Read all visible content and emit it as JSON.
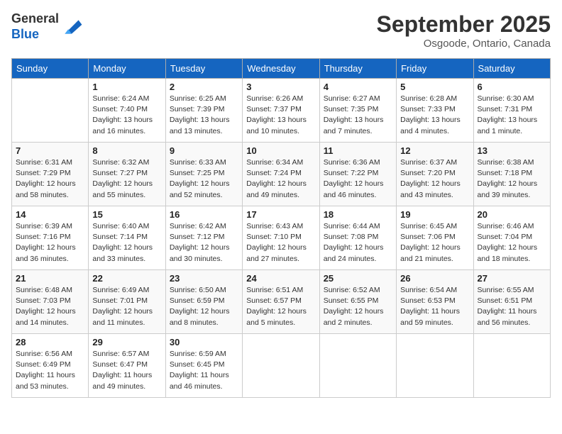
{
  "header": {
    "logo_line1": "General",
    "logo_line2": "Blue",
    "month": "September 2025",
    "location": "Osgoode, Ontario, Canada"
  },
  "days_of_week": [
    "Sunday",
    "Monday",
    "Tuesday",
    "Wednesday",
    "Thursday",
    "Friday",
    "Saturday"
  ],
  "weeks": [
    [
      {
        "day": "",
        "sunrise": "",
        "sunset": "",
        "daylight": ""
      },
      {
        "day": "1",
        "sunrise": "Sunrise: 6:24 AM",
        "sunset": "Sunset: 7:40 PM",
        "daylight": "Daylight: 13 hours and 16 minutes."
      },
      {
        "day": "2",
        "sunrise": "Sunrise: 6:25 AM",
        "sunset": "Sunset: 7:39 PM",
        "daylight": "Daylight: 13 hours and 13 minutes."
      },
      {
        "day": "3",
        "sunrise": "Sunrise: 6:26 AM",
        "sunset": "Sunset: 7:37 PM",
        "daylight": "Daylight: 13 hours and 10 minutes."
      },
      {
        "day": "4",
        "sunrise": "Sunrise: 6:27 AM",
        "sunset": "Sunset: 7:35 PM",
        "daylight": "Daylight: 13 hours and 7 minutes."
      },
      {
        "day": "5",
        "sunrise": "Sunrise: 6:28 AM",
        "sunset": "Sunset: 7:33 PM",
        "daylight": "Daylight: 13 hours and 4 minutes."
      },
      {
        "day": "6",
        "sunrise": "Sunrise: 6:30 AM",
        "sunset": "Sunset: 7:31 PM",
        "daylight": "Daylight: 13 hours and 1 minute."
      }
    ],
    [
      {
        "day": "7",
        "sunrise": "Sunrise: 6:31 AM",
        "sunset": "Sunset: 7:29 PM",
        "daylight": "Daylight: 12 hours and 58 minutes."
      },
      {
        "day": "8",
        "sunrise": "Sunrise: 6:32 AM",
        "sunset": "Sunset: 7:27 PM",
        "daylight": "Daylight: 12 hours and 55 minutes."
      },
      {
        "day": "9",
        "sunrise": "Sunrise: 6:33 AM",
        "sunset": "Sunset: 7:25 PM",
        "daylight": "Daylight: 12 hours and 52 minutes."
      },
      {
        "day": "10",
        "sunrise": "Sunrise: 6:34 AM",
        "sunset": "Sunset: 7:24 PM",
        "daylight": "Daylight: 12 hours and 49 minutes."
      },
      {
        "day": "11",
        "sunrise": "Sunrise: 6:36 AM",
        "sunset": "Sunset: 7:22 PM",
        "daylight": "Daylight: 12 hours and 46 minutes."
      },
      {
        "day": "12",
        "sunrise": "Sunrise: 6:37 AM",
        "sunset": "Sunset: 7:20 PM",
        "daylight": "Daylight: 12 hours and 43 minutes."
      },
      {
        "day": "13",
        "sunrise": "Sunrise: 6:38 AM",
        "sunset": "Sunset: 7:18 PM",
        "daylight": "Daylight: 12 hours and 39 minutes."
      }
    ],
    [
      {
        "day": "14",
        "sunrise": "Sunrise: 6:39 AM",
        "sunset": "Sunset: 7:16 PM",
        "daylight": "Daylight: 12 hours and 36 minutes."
      },
      {
        "day": "15",
        "sunrise": "Sunrise: 6:40 AM",
        "sunset": "Sunset: 7:14 PM",
        "daylight": "Daylight: 12 hours and 33 minutes."
      },
      {
        "day": "16",
        "sunrise": "Sunrise: 6:42 AM",
        "sunset": "Sunset: 7:12 PM",
        "daylight": "Daylight: 12 hours and 30 minutes."
      },
      {
        "day": "17",
        "sunrise": "Sunrise: 6:43 AM",
        "sunset": "Sunset: 7:10 PM",
        "daylight": "Daylight: 12 hours and 27 minutes."
      },
      {
        "day": "18",
        "sunrise": "Sunrise: 6:44 AM",
        "sunset": "Sunset: 7:08 PM",
        "daylight": "Daylight: 12 hours and 24 minutes."
      },
      {
        "day": "19",
        "sunrise": "Sunrise: 6:45 AM",
        "sunset": "Sunset: 7:06 PM",
        "daylight": "Daylight: 12 hours and 21 minutes."
      },
      {
        "day": "20",
        "sunrise": "Sunrise: 6:46 AM",
        "sunset": "Sunset: 7:04 PM",
        "daylight": "Daylight: 12 hours and 18 minutes."
      }
    ],
    [
      {
        "day": "21",
        "sunrise": "Sunrise: 6:48 AM",
        "sunset": "Sunset: 7:03 PM",
        "daylight": "Daylight: 12 hours and 14 minutes."
      },
      {
        "day": "22",
        "sunrise": "Sunrise: 6:49 AM",
        "sunset": "Sunset: 7:01 PM",
        "daylight": "Daylight: 12 hours and 11 minutes."
      },
      {
        "day": "23",
        "sunrise": "Sunrise: 6:50 AM",
        "sunset": "Sunset: 6:59 PM",
        "daylight": "Daylight: 12 hours and 8 minutes."
      },
      {
        "day": "24",
        "sunrise": "Sunrise: 6:51 AM",
        "sunset": "Sunset: 6:57 PM",
        "daylight": "Daylight: 12 hours and 5 minutes."
      },
      {
        "day": "25",
        "sunrise": "Sunrise: 6:52 AM",
        "sunset": "Sunset: 6:55 PM",
        "daylight": "Daylight: 12 hours and 2 minutes."
      },
      {
        "day": "26",
        "sunrise": "Sunrise: 6:54 AM",
        "sunset": "Sunset: 6:53 PM",
        "daylight": "Daylight: 11 hours and 59 minutes."
      },
      {
        "day": "27",
        "sunrise": "Sunrise: 6:55 AM",
        "sunset": "Sunset: 6:51 PM",
        "daylight": "Daylight: 11 hours and 56 minutes."
      }
    ],
    [
      {
        "day": "28",
        "sunrise": "Sunrise: 6:56 AM",
        "sunset": "Sunset: 6:49 PM",
        "daylight": "Daylight: 11 hours and 53 minutes."
      },
      {
        "day": "29",
        "sunrise": "Sunrise: 6:57 AM",
        "sunset": "Sunset: 6:47 PM",
        "daylight": "Daylight: 11 hours and 49 minutes."
      },
      {
        "day": "30",
        "sunrise": "Sunrise: 6:59 AM",
        "sunset": "Sunset: 6:45 PM",
        "daylight": "Daylight: 11 hours and 46 minutes."
      },
      {
        "day": "",
        "sunrise": "",
        "sunset": "",
        "daylight": ""
      },
      {
        "day": "",
        "sunrise": "",
        "sunset": "",
        "daylight": ""
      },
      {
        "day": "",
        "sunrise": "",
        "sunset": "",
        "daylight": ""
      },
      {
        "day": "",
        "sunrise": "",
        "sunset": "",
        "daylight": ""
      }
    ]
  ]
}
